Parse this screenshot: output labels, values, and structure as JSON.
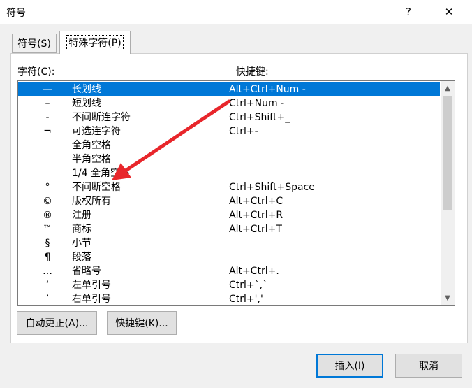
{
  "window": {
    "title": "符号",
    "help_label": "?",
    "close_label": "✕"
  },
  "tabs": [
    {
      "label": "符号(S)",
      "active": false
    },
    {
      "label": "特殊字符(P)",
      "active": true
    }
  ],
  "columns": {
    "character": "字符(C):",
    "shortcut": "快捷键:"
  },
  "rows": [
    {
      "symbol": "—",
      "name": "长划线",
      "shortcut": "Alt+Ctrl+Num -",
      "selected": true
    },
    {
      "symbol": "–",
      "name": "短划线",
      "shortcut": "Ctrl+Num -"
    },
    {
      "symbol": "-",
      "name": "不间断连字符",
      "shortcut": "Ctrl+Shift+_"
    },
    {
      "symbol": "¬",
      "name": "可选连字符",
      "shortcut": "Ctrl+-"
    },
    {
      "symbol": "",
      "name": "全角空格",
      "shortcut": ""
    },
    {
      "symbol": "",
      "name": "半角空格",
      "shortcut": ""
    },
    {
      "symbol": "",
      "name": "1/4 全角空格",
      "shortcut": ""
    },
    {
      "symbol": "°",
      "name": "不间断空格",
      "shortcut": "Ctrl+Shift+Space"
    },
    {
      "symbol": "©",
      "name": "版权所有",
      "shortcut": "Alt+Ctrl+C"
    },
    {
      "symbol": "®",
      "name": "注册",
      "shortcut": "Alt+Ctrl+R"
    },
    {
      "symbol": "™",
      "name": "商标",
      "shortcut": "Alt+Ctrl+T"
    },
    {
      "symbol": "§",
      "name": "小节",
      "shortcut": ""
    },
    {
      "symbol": "¶",
      "name": "段落",
      "shortcut": ""
    },
    {
      "symbol": "…",
      "name": "省略号",
      "shortcut": "Alt+Ctrl+."
    },
    {
      "symbol": "‘",
      "name": "左单引号",
      "shortcut": "Ctrl+`,`"
    },
    {
      "symbol": "’",
      "name": "右单引号",
      "shortcut": "Ctrl+','"
    }
  ],
  "buttons": {
    "autocorrect": "自动更正(A)...",
    "shortcut_key": "快捷键(K)...",
    "insert": "插入(I)",
    "cancel": "取消"
  },
  "colors": {
    "selection": "#0078d7",
    "arrow": "#e8262b"
  }
}
